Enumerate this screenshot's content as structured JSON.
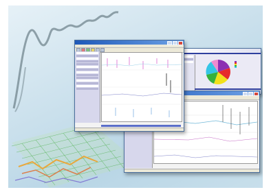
{
  "window_main": {
    "title": "",
    "menu_text": "",
    "toolbar_text": "",
    "tabs": []
  },
  "window_pie": {
    "title": "",
    "header_text": "",
    "legend": []
  },
  "window_bottom": {
    "title": "",
    "toolbar_text": ""
  },
  "colors": {
    "title_blue": "#1e58b8",
    "panel_lavender": "#d7d7ec",
    "pie_purple": "#8c2fb2",
    "pie_red": "#e62b2b",
    "pie_yellow": "#f2e11c",
    "pie_cyan": "#35c5e6",
    "pie_green": "#36b13d",
    "pie_pink": "#f08bd0"
  },
  "icons": [
    "window-minimize-icon",
    "window-maximize-icon",
    "window-close-icon",
    "toolbar-tool-icon"
  ]
}
